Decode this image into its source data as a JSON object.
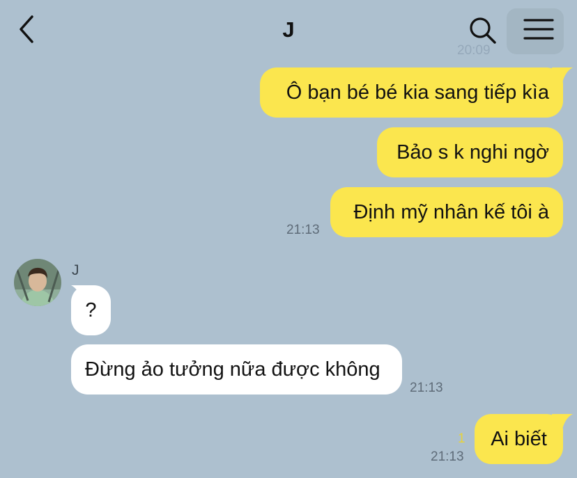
{
  "header": {
    "title": "J",
    "faded_time": "20:09",
    "icons": [
      "back-chevron-icon",
      "search-icon",
      "menu-icon"
    ]
  },
  "messages": {
    "out1": "Ô bạn bé bé kia sang tiếp kìa",
    "out2": "Bảo s k nghi ngờ",
    "out3": "Định mỹ nhân kế tôi à",
    "out3_time": "21:13",
    "sender_name": "J",
    "in1": "?",
    "in2": "Đừng ảo tưởng nữa được không",
    "in2_time": "21:13",
    "out4_read": "1",
    "out4": "Ai biết",
    "out4_time": "21:13"
  },
  "colors": {
    "background": "#adc0cf",
    "outgoing_bubble": "#fbe64e",
    "incoming_bubble": "#ffffff"
  }
}
